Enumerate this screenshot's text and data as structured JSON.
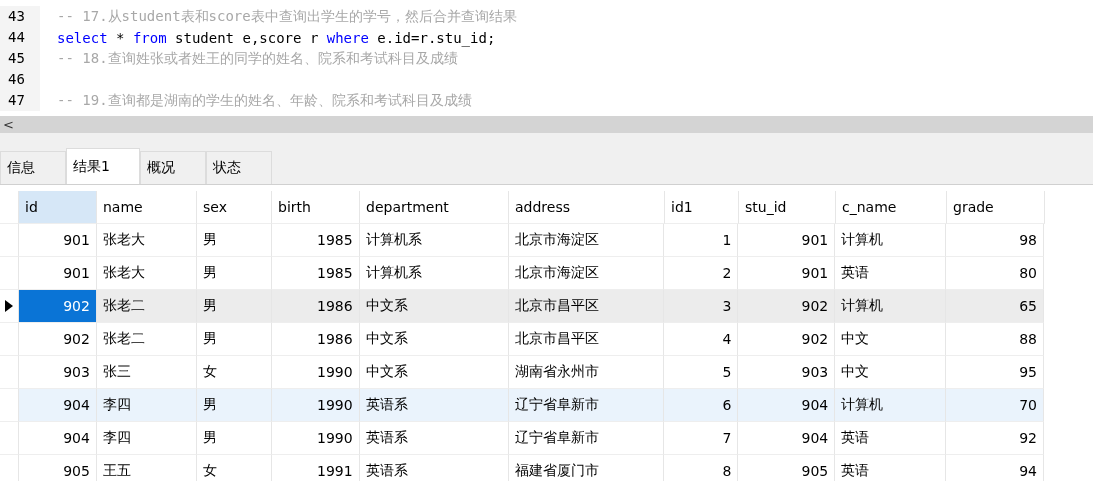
{
  "editor": {
    "lines": [
      {
        "number": "43",
        "tokens": [
          {
            "kind": "comment",
            "text": "-- 17.从student表和score表中查询出学生的学号，然后合并查询结果"
          }
        ]
      },
      {
        "number": "44",
        "tokens": [
          {
            "kind": "keyword",
            "text": "select"
          },
          {
            "kind": "plain",
            "text": " * "
          },
          {
            "kind": "keyword",
            "text": "from"
          },
          {
            "kind": "plain",
            "text": " student e,score r "
          },
          {
            "kind": "keyword",
            "text": "where"
          },
          {
            "kind": "plain",
            "text": " e.id=r.stu_id;"
          }
        ]
      },
      {
        "number": "45",
        "tokens": [
          {
            "kind": "comment",
            "text": "-- 18.查询姓张或者姓王的同学的姓名、院系和考试科目及成绩"
          }
        ]
      },
      {
        "number": "46"
      },
      {
        "number": "47",
        "tokens": [
          {
            "kind": "comment",
            "text": "-- 19.查询都是湖南的学生的姓名、年龄、院系和考试科目及成绩"
          }
        ]
      }
    ],
    "scroll_arrow": "<"
  },
  "tabs": [
    {
      "label": "信息",
      "selected": false
    },
    {
      "label": "结果1",
      "selected": true
    },
    {
      "label": "概况",
      "selected": false
    },
    {
      "label": "状态",
      "selected": false
    }
  ],
  "table": {
    "columns": [
      {
        "label": "id",
        "kind": "number",
        "selected": true
      },
      {
        "label": "name",
        "kind": "text",
        "selected": false
      },
      {
        "label": "sex",
        "kind": "text",
        "selected": false
      },
      {
        "label": "birth",
        "kind": "number",
        "selected": false
      },
      {
        "label": "department",
        "kind": "text",
        "selected": false
      },
      {
        "label": "address",
        "kind": "text",
        "selected": false
      },
      {
        "label": "id1",
        "kind": "number",
        "selected": false
      },
      {
        "label": "stu_id",
        "kind": "number",
        "selected": false
      },
      {
        "label": "c_name",
        "kind": "text",
        "selected": false
      },
      {
        "label": "grade",
        "kind": "number",
        "selected": false
      }
    ],
    "rows": [
      {
        "selected": false,
        "hovered": false,
        "cells": [
          "901",
          "张老大",
          "男",
          "1985",
          "计算机系",
          "北京市海淀区",
          "1",
          "901",
          "计算机",
          "98"
        ]
      },
      {
        "selected": false,
        "hovered": false,
        "cells": [
          "901",
          "张老大",
          "男",
          "1985",
          "计算机系",
          "北京市海淀区",
          "2",
          "901",
          "英语",
          "80"
        ]
      },
      {
        "selected": true,
        "hovered": false,
        "cells": [
          "902",
          "张老二",
          "男",
          "1986",
          "中文系",
          "北京市昌平区",
          "3",
          "902",
          "计算机",
          "65"
        ]
      },
      {
        "selected": false,
        "hovered": false,
        "cells": [
          "902",
          "张老二",
          "男",
          "1986",
          "中文系",
          "北京市昌平区",
          "4",
          "902",
          "中文",
          "88"
        ]
      },
      {
        "selected": false,
        "hovered": false,
        "cells": [
          "903",
          "张三",
          "女",
          "1990",
          "中文系",
          "湖南省永州市",
          "5",
          "903",
          "中文",
          "95"
        ]
      },
      {
        "selected": false,
        "hovered": true,
        "cells": [
          "904",
          "李四",
          "男",
          "1990",
          "英语系",
          "辽宁省阜新市",
          "6",
          "904",
          "计算机",
          "70"
        ]
      },
      {
        "selected": false,
        "hovered": false,
        "cells": [
          "904",
          "李四",
          "男",
          "1990",
          "英语系",
          "辽宁省阜新市",
          "7",
          "904",
          "英语",
          "92"
        ]
      },
      {
        "selected": false,
        "hovered": false,
        "cells": [
          "905",
          "王五",
          "女",
          "1991",
          "英语系",
          "福建省厦门市",
          "8",
          "905",
          "英语",
          "94"
        ]
      }
    ]
  }
}
